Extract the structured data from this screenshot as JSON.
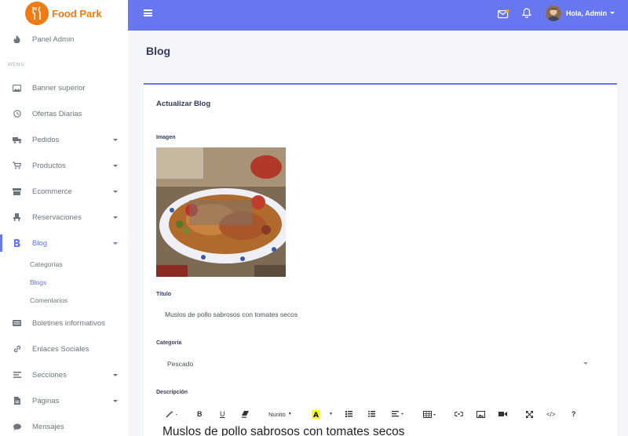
{
  "brand": {
    "name": "Food Park",
    "color": "#f07b14"
  },
  "sidebar": {
    "top_item": "Panel Admin",
    "menu_header": "MENU",
    "items": [
      {
        "label": "Banner superior",
        "icon": "image-icon"
      },
      {
        "label": "Ofertas Diarias",
        "icon": "clock-icon"
      },
      {
        "label": "Pedidos",
        "icon": "truck-icon",
        "dropdown": true
      },
      {
        "label": "Productos",
        "icon": "cart-icon",
        "dropdown": true
      },
      {
        "label": "Ecommerce",
        "icon": "store-icon",
        "dropdown": true
      },
      {
        "label": "Reservaciones",
        "icon": "chair-icon",
        "dropdown": true
      },
      {
        "label": "Blog",
        "icon": "bold-icon",
        "dropdown": true,
        "active": true
      },
      {
        "label": "Boletines informativos",
        "icon": "newsletter-icon"
      },
      {
        "label": "Enlaces Sociales",
        "icon": "link-icon"
      },
      {
        "label": "Secciones",
        "icon": "list-icon",
        "dropdown": true
      },
      {
        "label": "Páginas",
        "icon": "file-icon",
        "dropdown": true
      },
      {
        "label": "Mensajes",
        "icon": "chat-icon"
      }
    ],
    "blog_sub": [
      "Categorías",
      "Blogs",
      "Comentarios"
    ]
  },
  "topbar": {
    "user": "Hola, Admin",
    "accent": "#6777ef"
  },
  "page": {
    "title": "Blog"
  },
  "form": {
    "card_title": "Actualizar Blog",
    "image_label": "Imagen",
    "title_label": "Título",
    "title_value": "Muslos de pollo sabrosos con tomates secos",
    "category_label": "Categoría",
    "category_value": "Pescado",
    "description_label": "Descripción",
    "toolbar_font": "Nunito",
    "editor_text": "Muslos de pollo sabrosos con tomates secos"
  }
}
